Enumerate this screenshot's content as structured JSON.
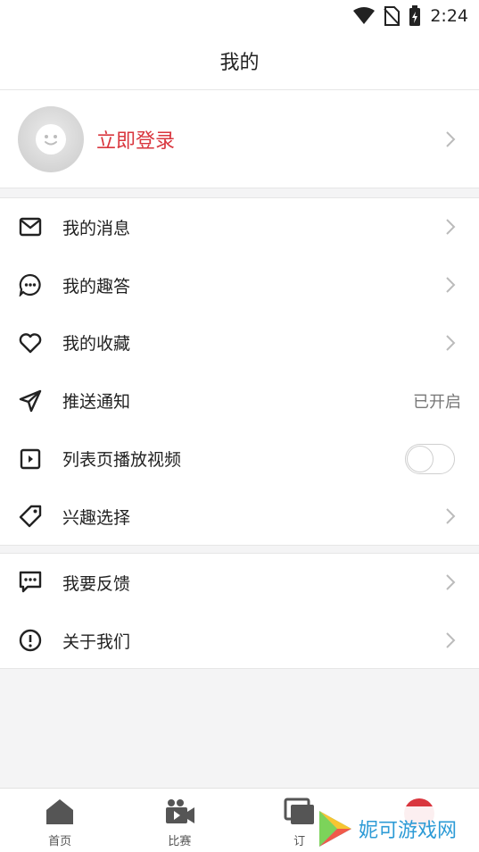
{
  "status_bar": {
    "time": "2:24",
    "icons": [
      "wifi-icon",
      "no-sim-icon",
      "battery-charging-icon"
    ]
  },
  "header": {
    "title": "我的"
  },
  "profile": {
    "login_label": "立即登录"
  },
  "menu_section_1": [
    {
      "icon": "mail-icon",
      "label": "我的消息"
    },
    {
      "icon": "chat-bubble-icon",
      "label": "我的趣答"
    },
    {
      "icon": "heart-icon",
      "label": "我的收藏"
    },
    {
      "icon": "send-icon",
      "label": "推送通知",
      "value": "已开启"
    },
    {
      "icon": "video-icon",
      "label": "列表页播放视频",
      "toggle": false
    },
    {
      "icon": "tag-icon",
      "label": "兴趣选择"
    }
  ],
  "menu_section_2": [
    {
      "icon": "feedback-icon",
      "label": "我要反馈"
    },
    {
      "icon": "info-icon",
      "label": "关于我们"
    }
  ],
  "tabbar": {
    "items": [
      {
        "icon": "home-icon",
        "label": "首页"
      },
      {
        "icon": "camera-icon",
        "label": "比赛"
      },
      {
        "icon": "subscribe-icon",
        "label": "订"
      },
      {
        "icon": "profile-icon",
        "label": ""
      }
    ]
  },
  "watermark": {
    "text": "妮可游戏网"
  },
  "colors": {
    "accent_red": "#d9363e",
    "watermark_blue": "#2d9bd6"
  }
}
